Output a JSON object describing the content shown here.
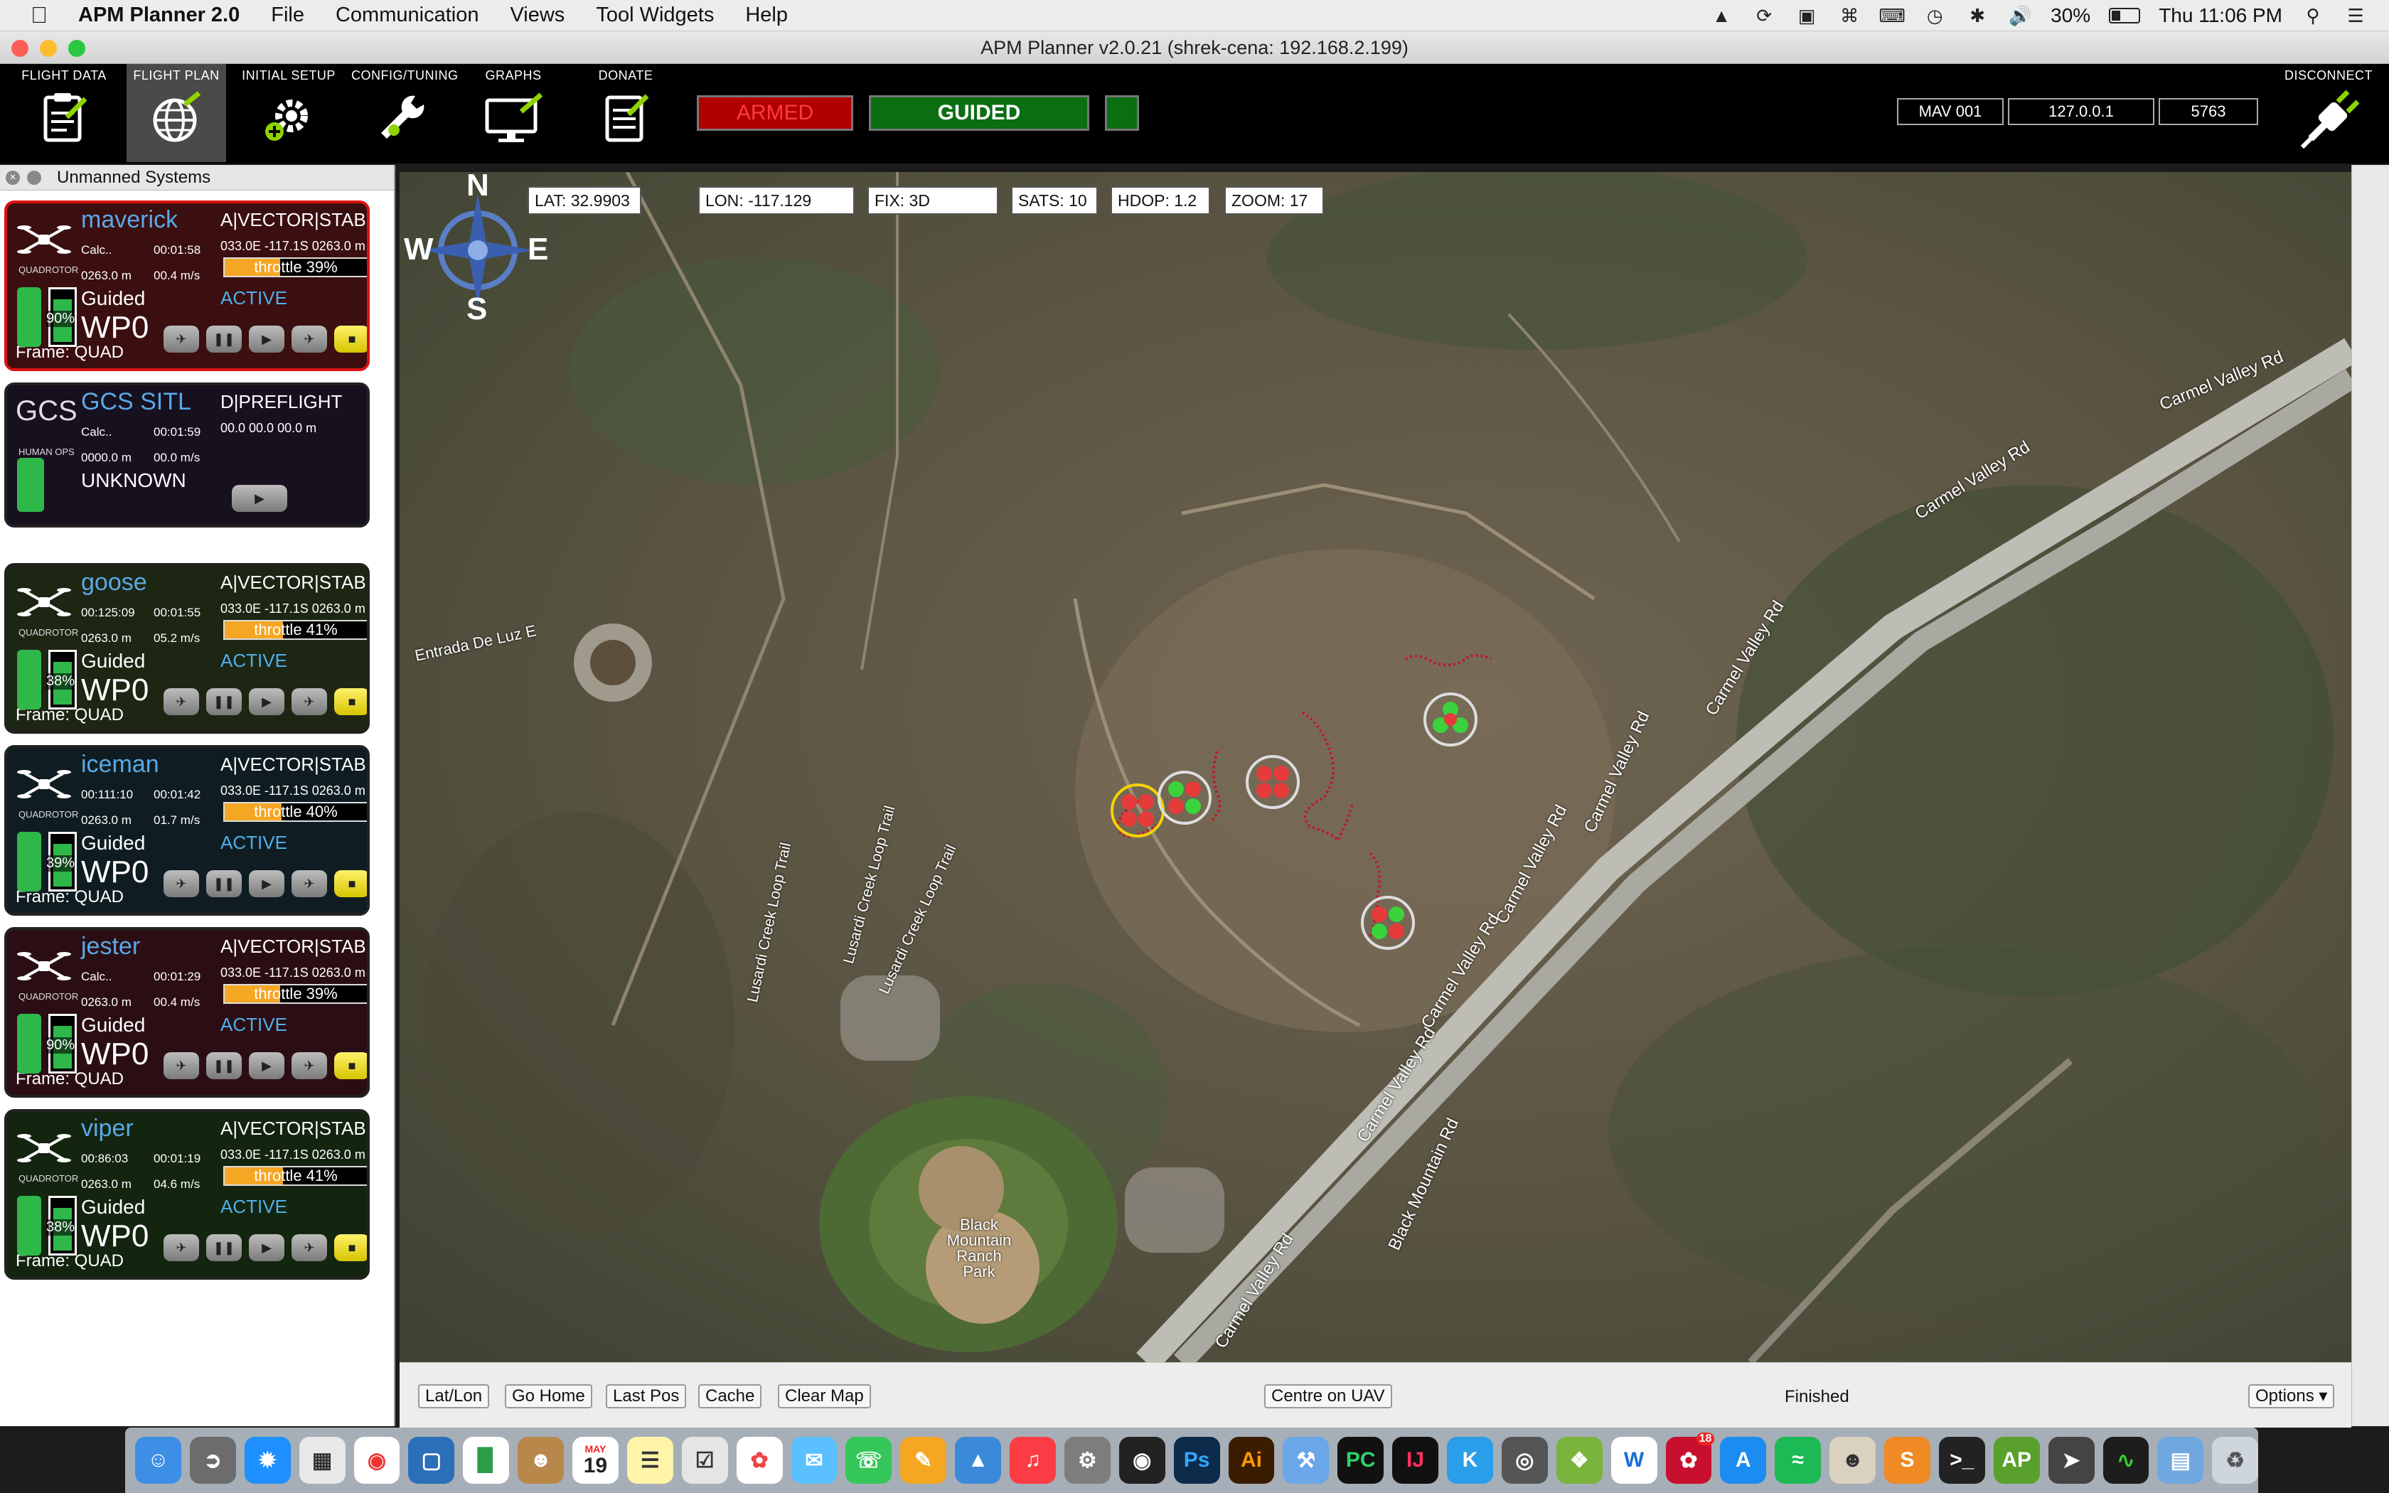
{
  "menubar": {
    "app_name": "APM Planner 2.0",
    "items": [
      "File",
      "Communication",
      "Views",
      "Tool Widgets",
      "Help"
    ],
    "battery": "30%",
    "clock": "Thu 11:06 PM"
  },
  "window": {
    "title": "APM Planner v2.0.21 (shrek-cena: 192.168.2.199)"
  },
  "toolbar": {
    "buttons": [
      {
        "label": "FLIGHT DATA",
        "icon": "clipboard-icon"
      },
      {
        "label": "FLIGHT PLAN",
        "icon": "globe-icon"
      },
      {
        "label": "INITIAL SETUP",
        "icon": "gear-icon"
      },
      {
        "label": "CONFIG/TUNING",
        "icon": "wrench-icon"
      },
      {
        "label": "GRAPHS",
        "icon": "monitor-icon"
      },
      {
        "label": "DONATE",
        "icon": "document-icon"
      }
    ],
    "armed_label": "ARMED",
    "mode_label": "GUIDED",
    "mav_id": "MAV 001",
    "ip": "127.0.0.1",
    "port": "5763",
    "disconnect_label": "DISCONNECT",
    "colors": {
      "armed_bg": "#b00000",
      "armed_text": "#ff3333",
      "guided_bg": "#0a6e12"
    }
  },
  "sidebar": {
    "title": "Unmanned Systems",
    "cards": [
      {
        "name": "maverick",
        "mode": "A|VECTOR|STABI",
        "time1": "Calc..",
        "time2": "00:01:58",
        "coord": "033.0E -117.1S 0263.0 m",
        "alt": "0263.0 m",
        "speed": "00.4 m/s",
        "throttle_label": "throttle 39%",
        "throttle_pct": 39,
        "flight_mode": "Guided",
        "status": "ACTIVE",
        "waypoint": "WP0",
        "frame": "Frame: QUAD",
        "battery_label": "90%",
        "type_label": "QUADROTOR",
        "border": "#d11",
        "bg": "#3b0e10"
      },
      {
        "name": "GCS SITL",
        "mode": "D|PREFLIGHT",
        "time1": "Calc..",
        "time2": "00:01:59",
        "coord": "00.0  00.0  00.0 m",
        "alt": "0000.0 m",
        "speed": "00.0 m/s",
        "flight_mode": "UNKNOWN",
        "type_label": "HUMAN OPS",
        "logo": "GCS",
        "border": "#222",
        "bg": "#17101f"
      },
      {
        "name": "goose",
        "mode": "A|VECTOR|STABI",
        "time1": "00:125:09",
        "time2": "00:01:55",
        "coord": "033.0E -117.1S 0263.0 m",
        "alt": "0263.0 m",
        "speed": "05.2 m/s",
        "throttle_label": "throttle 41%",
        "throttle_pct": 41,
        "flight_mode": "Guided",
        "status": "ACTIVE",
        "waypoint": "WP0",
        "frame": "Frame: QUAD",
        "battery_label": "38%",
        "type_label": "QUADROTOR",
        "border": "#222",
        "bg": "#1d2513"
      },
      {
        "name": "iceman",
        "mode": "A|VECTOR|STABI",
        "time1": "00:111:10",
        "time2": "00:01:42",
        "coord": "033.0E -117.1S 0263.0 m",
        "alt": "0263.0 m",
        "speed": "01.7 m/s",
        "throttle_label": "throttle 40%",
        "throttle_pct": 40,
        "flight_mode": "Guided",
        "status": "ACTIVE",
        "waypoint": "WP0",
        "frame": "Frame: QUAD",
        "battery_label": "39%",
        "type_label": "QUADROTOR",
        "border": "#222",
        "bg": "#0f1d22"
      },
      {
        "name": "jester",
        "mode": "A|VECTOR|STABI",
        "time1": "Calc..",
        "time2": "00:01:29",
        "coord": "033.0E -117.1S 0263.0 m",
        "alt": "0263.0 m",
        "speed": "00.4 m/s",
        "throttle_label": "throttle 39%",
        "throttle_pct": 39,
        "flight_mode": "Guided",
        "status": "ACTIVE",
        "waypoint": "WP0",
        "frame": "Frame: QUAD",
        "battery_label": "90%",
        "type_label": "QUADROTOR",
        "border": "#222",
        "bg": "#2b0e14"
      },
      {
        "name": "viper",
        "mode": "A|VECTOR|STABI",
        "time1": "00:86:03",
        "time2": "00:01:19",
        "coord": "033.0E -117.1S 0263.0 m",
        "alt": "0263.0 m",
        "speed": "04.6 m/s",
        "throttle_label": "throttle 41%",
        "throttle_pct": 41,
        "flight_mode": "Guided",
        "status": "ACTIVE",
        "waypoint": "WP0",
        "frame": "Frame: QUAD",
        "battery_label": "38%",
        "type_label": "QUADROTOR",
        "border": "#222",
        "bg": "#13240f"
      }
    ]
  },
  "map": {
    "compass": {
      "n": "N",
      "s": "S",
      "e": "E",
      "w": "W"
    },
    "lat": "LAT: 32.9903",
    "lon": "LON: -117.129",
    "fix": "FIX: 3D",
    "sats": "SATS: 10",
    "hdop": "HDOP: 1.2",
    "zoom": "ZOOM: 17",
    "labels": {
      "entrada": "Entrada De Luz E",
      "trail1": "Lusardi Creek Loop Trail",
      "trail2": "Lusardi Creek Loop Trail",
      "trail3": "Lusardi Creek Loop Trail",
      "carmel1": "Carmel Valley Rd",
      "carmel2": "Carmel Valley Rd",
      "carmel3": "Carmel Valley Rd",
      "carmel4": "Carmel Valley Rd",
      "carmel5": "Carmel Valley Rd",
      "carmel6": "Carmel Valley Rd",
      "carmel7": "Carmel Valley Rd",
      "carmel8": "Carmel Valley Rd",
      "blackmtn": "Black Mountain Rd",
      "park": "Black Mountain Ranch Park"
    }
  },
  "bottombar": {
    "latlon": "Lat/Lon",
    "go_home": "Go Home",
    "last_pos": "Last Pos",
    "cache": "Cache",
    "clear_map": "Clear Map",
    "centre": "Centre on UAV",
    "status": "Finished",
    "options": "Options"
  },
  "dock": {
    "calendar_month": "MAY",
    "calendar_day": "19",
    "badge": "18"
  }
}
